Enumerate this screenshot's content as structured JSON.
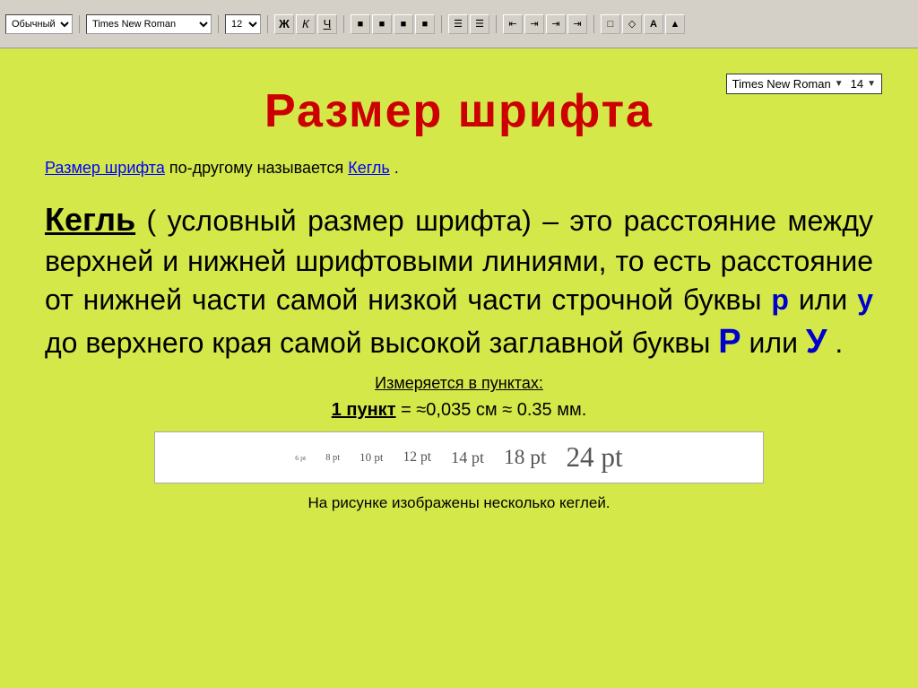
{
  "toolbar": {
    "style_select": "Обычный",
    "font_select": "Times New Roman",
    "size_select": "12",
    "bold_label": "Ж",
    "italic_label": "К",
    "underline_label": "Ч",
    "align_buttons": [
      "≡",
      "≡",
      "≡",
      "≡"
    ],
    "list_buttons": [
      "≔",
      "≔"
    ],
    "indent_buttons": [
      "⇤",
      "⇥"
    ],
    "color_buttons": [
      "A",
      "▲"
    ]
  },
  "font_box": {
    "name": "Times New Roman",
    "size": "14"
  },
  "slide": {
    "title": "Размер шрифта",
    "first_para_part1": "Размер шрифта",
    "first_para_mid": " по-другому называется ",
    "first_para_kegль": "Кегль",
    "first_para_end": ".",
    "main_text_start": " ( условный размер шрифта) – это расстояние между верхней и нижней шрифтовыми линиями, то есть расстояние от нижней части самой низкой части строчной буквы ",
    "letter_p": "р",
    "main_text_mid": " или ",
    "letter_y": "у",
    "main_text_cont": " до верхнего края самой высокой заглавной буквы ",
    "letter_P_big": "Р",
    "main_text_or": " или ",
    "letter_Y_big": "У",
    "main_text_end": ".",
    "kegль_label": "Кегль",
    "izmeryaetsya": "Измеряется в пунктах:",
    "punkt_label": "1 пункт",
    "punkt_value": " = ≈0,035 см ≈ 0.35 мм.",
    "points": [
      {
        "label": "6 pt",
        "size": 6
      },
      {
        "label": "8 pt",
        "size": 8
      },
      {
        "label": "10 pt",
        "size": 10
      },
      {
        "label": "12 pt",
        "size": 12
      },
      {
        "label": "14 pt",
        "size": 14
      },
      {
        "label": "18 pt",
        "size": 18
      },
      {
        "label": "24 pt",
        "size": 24
      }
    ],
    "caption": "На рисунке изображены несколько кеглей."
  }
}
